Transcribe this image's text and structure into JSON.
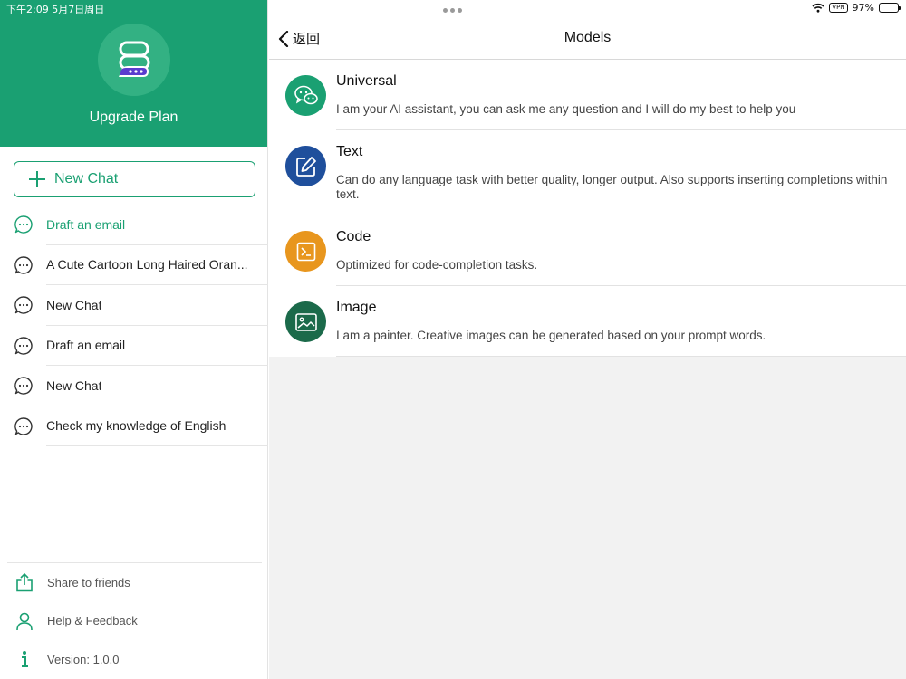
{
  "status_bar": {
    "time": "下午2:09   5月7日周日",
    "vpn": "VPN",
    "battery": "97%",
    "battery_level": 0.97
  },
  "sidebar": {
    "upgrade_label": "Upgrade Plan",
    "new_chat_label": "New Chat",
    "chats": [
      {
        "title": "Draft an email",
        "active": true
      },
      {
        "title": "A Cute Cartoon Long Haired Oran...",
        "active": false
      },
      {
        "title": "New Chat",
        "active": false
      },
      {
        "title": "Draft an email",
        "active": false
      },
      {
        "title": "New Chat",
        "active": false
      },
      {
        "title": "Check my knowledge of English",
        "active": false
      }
    ],
    "footer": [
      {
        "label": "Share to friends",
        "icon": "share-icon"
      },
      {
        "label": "Help & Feedback",
        "icon": "person-icon"
      },
      {
        "label": "Version: 1.0.0",
        "icon": "info-icon"
      }
    ]
  },
  "main": {
    "back_label": "返回",
    "title": "Models",
    "models": [
      {
        "name": "Universal",
        "description": "I am your AI assistant, you can ask me any question and I will do my best to help you",
        "icon": "wechat-icon",
        "color": "#1aa072"
      },
      {
        "name": "Text",
        "description": "Can do any language task with better quality, longer output. Also supports inserting completions within text.",
        "icon": "edit-icon",
        "color": "#1f4f9c"
      },
      {
        "name": "Code",
        "description": "Optimized for code-completion tasks.",
        "icon": "terminal-icon",
        "color": "#e8961e"
      },
      {
        "name": "Image",
        "description": "I am a painter. Creative images can be generated based on your prompt words.",
        "icon": "image-icon",
        "color": "#1b6a4a"
      }
    ]
  },
  "colors": {
    "brand": "#1aa072",
    "brand_light": "#33b183",
    "logo_accent": "#5b3ccf"
  }
}
